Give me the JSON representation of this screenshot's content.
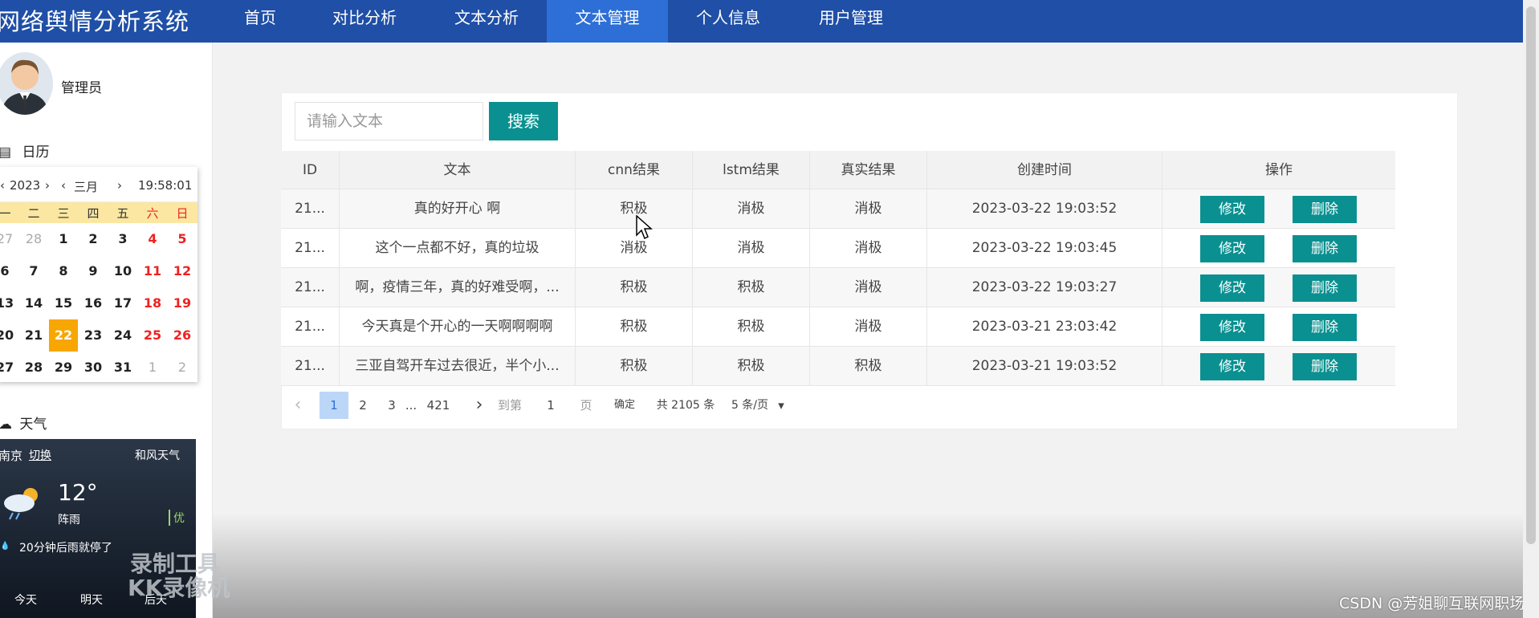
{
  "app": {
    "title": "网络舆情分析系统"
  },
  "nav": {
    "items": [
      {
        "label": "首页"
      },
      {
        "label": "对比分析"
      },
      {
        "label": "文本分析"
      },
      {
        "label": "文本管理"
      },
      {
        "label": "个人信息"
      },
      {
        "label": "用户管理"
      }
    ],
    "active": "文本管理"
  },
  "sidebar": {
    "user": {
      "name": "管理员"
    },
    "calendar_title": "日历",
    "calendar": {
      "year": "2023",
      "month": "三月",
      "time": "19:58:01",
      "weekdays": [
        "一",
        "二",
        "三",
        "四",
        "五",
        "六",
        "日"
      ],
      "weeks": [
        [
          "27",
          "28",
          "1",
          "2",
          "3",
          "4",
          "5"
        ],
        [
          "6",
          "7",
          "8",
          "9",
          "10",
          "11",
          "12"
        ],
        [
          "13",
          "14",
          "15",
          "16",
          "17",
          "18",
          "19"
        ],
        [
          "20",
          "21",
          "22",
          "23",
          "24",
          "25",
          "26"
        ],
        [
          "27",
          "28",
          "29",
          "30",
          "31",
          "1",
          "2"
        ]
      ],
      "today": "22"
    },
    "weather_title": "天气",
    "weather": {
      "city": "南京",
      "switch_label": "切换",
      "provider": "和风天气",
      "temperature": "12°",
      "condition": "阵雨",
      "air_quality": "优",
      "forecast_note": "20分钟后雨就停了",
      "days": [
        "今天",
        "明天",
        "后天"
      ]
    }
  },
  "search": {
    "placeholder": "请输入文本",
    "button_label": "搜索"
  },
  "table": {
    "columns": [
      "ID",
      "文本",
      "cnn结果",
      "lstm结果",
      "真实结果",
      "创建时间",
      "操作"
    ],
    "rows": [
      {
        "id": "21...",
        "text": "真的好开心 啊",
        "cnn": "积极",
        "lstm": "消极",
        "real": "消极",
        "created": "2023-03-22 19:03:52"
      },
      {
        "id": "21...",
        "text": "这个一点都不好，真的垃圾",
        "cnn": "消极",
        "lstm": "消极",
        "real": "消极",
        "created": "2023-03-22 19:03:45"
      },
      {
        "id": "21...",
        "text": "啊，疫情三年，真的好难受啊，...",
        "cnn": "积极",
        "lstm": "积极",
        "real": "消极",
        "created": "2023-03-22 19:03:27"
      },
      {
        "id": "21...",
        "text": "今天真是个开心的一天啊啊啊啊",
        "cnn": "积极",
        "lstm": "积极",
        "real": "消极",
        "created": "2023-03-21 23:03:42"
      },
      {
        "id": "21...",
        "text": "三亚自驾开车过去很近，半个小...",
        "cnn": "积极",
        "lstm": "积极",
        "real": "积极",
        "created": "2023-03-21 19:03:52"
      }
    ],
    "edit_label": "修改",
    "delete_label": "删除"
  },
  "pagination": {
    "prev": "‹",
    "pages": [
      "1",
      "2",
      "3"
    ],
    "ellipsis": "...",
    "last_page": "421",
    "next": "›",
    "goto_label": "到第",
    "goto_value": "1",
    "page_unit": "页",
    "confirm_label": "确定",
    "total": "共 2105 条",
    "page_size": "5 条/页"
  },
  "overlay": {
    "watermark_line1": "录制工具",
    "watermark_line2": "KK录像机",
    "credit": "CSDN @芳姐聊互联网职场"
  }
}
